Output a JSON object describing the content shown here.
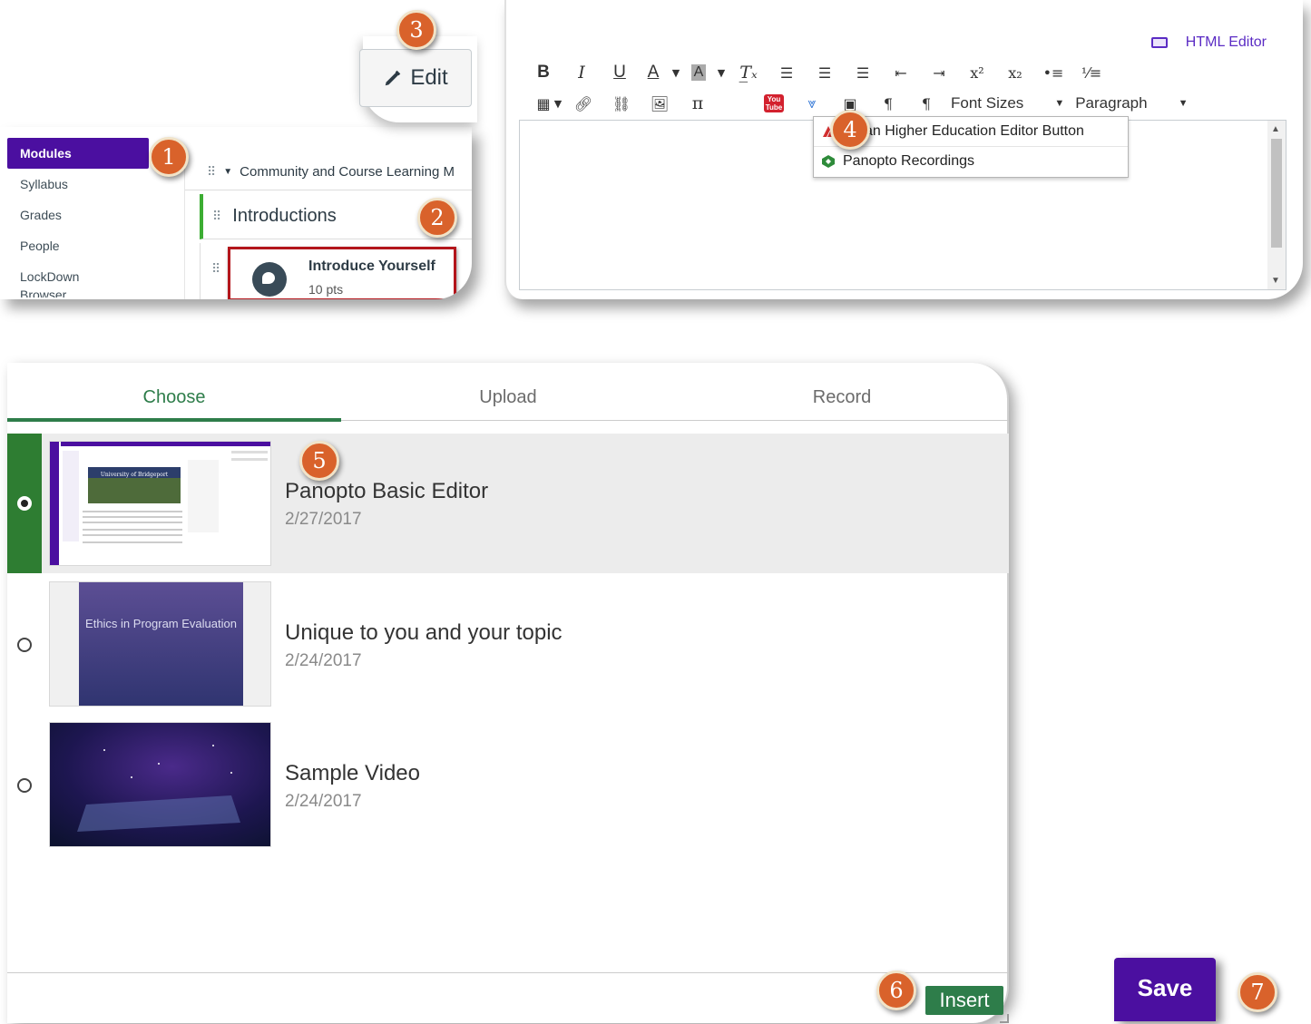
{
  "canvas": {
    "nav_items": [
      "Modules",
      "Syllabus",
      "Grades",
      "People",
      "LockDown",
      "Browser"
    ],
    "module_title": "Community and Course Learning M",
    "sub_header": "Introductions",
    "assignment": {
      "title": "Introduce Yourself",
      "points": "10 pts"
    }
  },
  "edit_button": {
    "label": "Edit"
  },
  "editor": {
    "html_editor_label": "HTML Editor",
    "font_sizes_label": "Font Sizes",
    "paragraph_label": "Paragraph",
    "youtube_text": "You Tube",
    "lti_menu": [
      "Macmillan Higher Education Editor Button",
      "Panopto Recordings"
    ],
    "lti_menu_visible": [
      "millan Higher Education Editor Button",
      "Panopto Recordings"
    ]
  },
  "chooser": {
    "tabs": [
      "Choose",
      "Upload",
      "Record"
    ],
    "videos": [
      {
        "title": "Panopto Basic Editor",
        "date": "2/27/2017",
        "selected": true,
        "thumb_text": "University of Bridgeport"
      },
      {
        "title": "Unique to you and your topic",
        "date": "2/24/2017",
        "selected": false,
        "thumb_text": "Ethics in Program Evaluation"
      },
      {
        "title": "Sample Video",
        "date": "2/24/2017",
        "selected": false,
        "thumb_text": ""
      }
    ],
    "insert_label": "Insert"
  },
  "save_label": "Save",
  "steps": [
    "1",
    "2",
    "3",
    "4",
    "5",
    "6",
    "7"
  ],
  "colors": {
    "canvas_purple": "#4b0fa0",
    "panopto_green": "#2e7d4a",
    "badge_orange": "#d9622b",
    "highlight_red": "#b3151b"
  }
}
